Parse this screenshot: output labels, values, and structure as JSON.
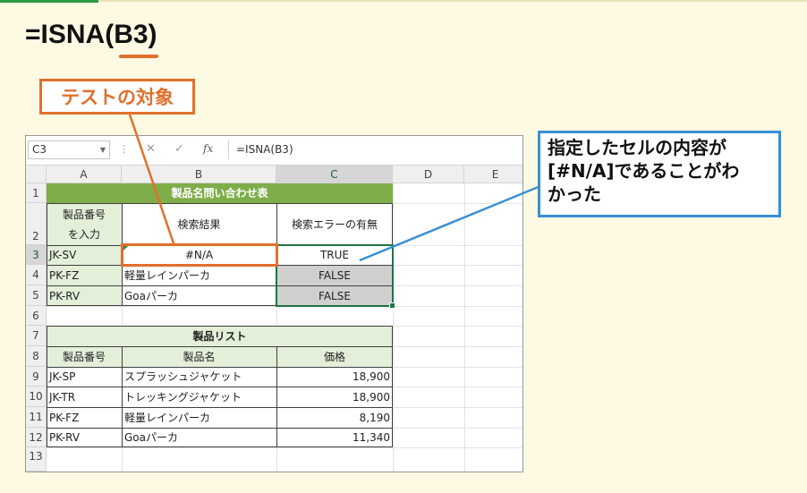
{
  "heading": {
    "prefix": "=ISNA(",
    "arg": "B3",
    "suffix": ")"
  },
  "callouts": {
    "target": "テストの対象",
    "result_lines": [
      "指定したセルの内容が",
      "[#N/A]であることがわ",
      "かった"
    ]
  },
  "formula_bar": {
    "name_box": "C3",
    "cancel_icon": "✕",
    "enter_icon": "✓",
    "fx": "fx",
    "formula": "=ISNA(B3)"
  },
  "columns": [
    "A",
    "B",
    "C",
    "D",
    "E"
  ],
  "rows": [
    "1",
    "2",
    "3",
    "4",
    "5",
    "6",
    "7",
    "8",
    "9",
    "10",
    "11",
    "12",
    "13"
  ],
  "table1": {
    "title": "製品名問い合わせ表",
    "header_a_line1": "製品番号",
    "header_a_line2": "を入力",
    "header_b": "検索結果",
    "header_c": "検索エラーの有無",
    "rows": [
      {
        "a": "JK-SV",
        "b": "#N/A",
        "c": "TRUE"
      },
      {
        "a": "PK-FZ",
        "b": "軽量レインパーカ",
        "c": "FALSE"
      },
      {
        "a": "PK-RV",
        "b": "Goaパーカ",
        "c": "FALSE"
      }
    ]
  },
  "table2": {
    "title": "製品リスト",
    "headers": [
      "製品番号",
      "製品名",
      "価格"
    ],
    "rows": [
      {
        "a": "JK-SP",
        "b": "スプラッシュジャケット",
        "c": "18,900"
      },
      {
        "a": "JK-TR",
        "b": "トレッキングジャケット",
        "c": "18,900"
      },
      {
        "a": "PK-FZ",
        "b": "軽量レインパーカ",
        "c": "8,190"
      },
      {
        "a": "PK-RV",
        "b": "Goaパーカ",
        "c": "11,340"
      }
    ]
  },
  "colors": {
    "orange": "#e1702c",
    "blue": "#3a8fd4",
    "green_header": "#7fad4a",
    "light_green": "#e3efd9",
    "gray_cell": "#d0d0d0"
  }
}
